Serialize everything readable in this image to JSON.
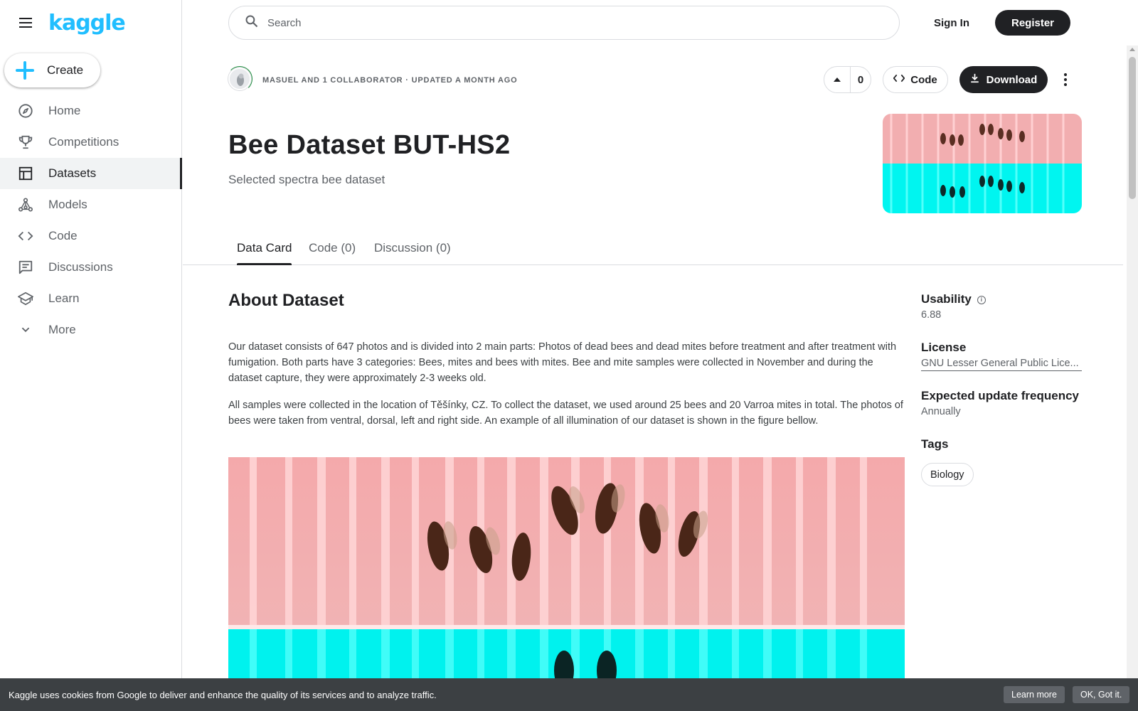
{
  "sidebar": {
    "logo": "kaggle",
    "create_label": "Create",
    "items": [
      {
        "label": "Home",
        "icon": "compass-icon"
      },
      {
        "label": "Competitions",
        "icon": "trophy-icon"
      },
      {
        "label": "Datasets",
        "icon": "table-icon",
        "active": true
      },
      {
        "label": "Models",
        "icon": "models-icon"
      },
      {
        "label": "Code",
        "icon": "code-icon"
      },
      {
        "label": "Discussions",
        "icon": "discussions-icon"
      },
      {
        "label": "Learn",
        "icon": "school-icon"
      },
      {
        "label": "More",
        "icon": "chevron-down-icon"
      }
    ]
  },
  "topbar": {
    "search_placeholder": "Search",
    "signin_label": "Sign In",
    "register_label": "Register"
  },
  "header": {
    "meta": "MASUEL AND 1 COLLABORATOR · UPDATED A MONTH AGO",
    "vote_count": "0",
    "code_label": "Code",
    "download_label": "Download",
    "title": "Bee Dataset BUT-HS2",
    "subtitle": "Selected spectra bee dataset"
  },
  "tabs": [
    {
      "label": "Data Card",
      "active": true
    },
    {
      "label": "Code (0)"
    },
    {
      "label": "Discussion (0)"
    }
  ],
  "content": {
    "heading": "About Dataset",
    "paragraphs": [
      "Our dataset consists of 647 photos and is divided into 2 main parts: Photos of dead bees and dead mites before treatment and after treatment with fumigation. Both parts have 3 categories: Bees, mites and bees with mites. Bee and mite samples were collected in November and during the dataset capture, they were approximately 2-3 weeks old.",
      "All samples were collected in the location of Těšínky, CZ. To collect the dataset, we used around 25 bees and 20 Varroa mites in total. The photos of bees were taken from ventral, dorsal, left and right side. An example of all illumination of our dataset is shown in the figure bellow."
    ]
  },
  "sidepanel": {
    "usability_label": "Usability",
    "usability_value": "6.88",
    "license_label": "License",
    "license_value": "GNU Lesser General Public Lice...",
    "frequency_label": "Expected update frequency",
    "frequency_value": "Annually",
    "tags_label": "Tags",
    "tags": [
      "Biology"
    ]
  },
  "cookie": {
    "text": "Kaggle uses cookies from Google to deliver and enhance the quality of its services and to analyze traffic.",
    "learn_more": "Learn more",
    "ok": "OK, Got it."
  },
  "colors": {
    "accent": "#20beff",
    "pink_panel": "#f2aeb0",
    "cyan_panel": "#00f5f0",
    "dark": "#202124"
  }
}
